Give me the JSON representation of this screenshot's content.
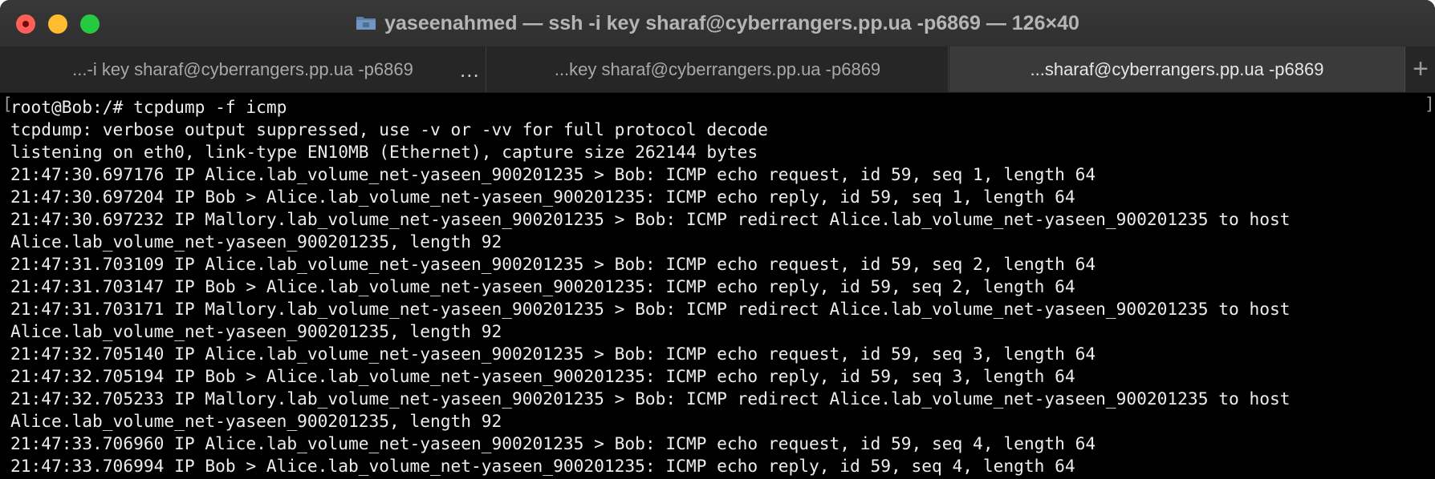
{
  "window": {
    "title": "yaseenahmed — ssh -i key sharaf@cyberrangers.pp.ua -p6869 — 126×40"
  },
  "tabs": [
    {
      "label": "...-i key sharaf@cyberrangers.pp.ua -p6869",
      "active": false
    },
    {
      "label": "...key sharaf@cyberrangers.pp.ua -p6869",
      "active": false
    },
    {
      "label": "...sharaf@cyberrangers.pp.ua -p6869",
      "active": true
    }
  ],
  "tab_overflow": "...",
  "new_tab_label": "+",
  "terminal": {
    "bracket_left": "[",
    "bracket_right": "]",
    "lines": [
      "root@Bob:/# tcpdump -f icmp",
      "tcpdump: verbose output suppressed, use -v or -vv for full protocol decode",
      "listening on eth0, link-type EN10MB (Ethernet), capture size 262144 bytes",
      "21:47:30.697176 IP Alice.lab_volume_net-yaseen_900201235 > Bob: ICMP echo request, id 59, seq 1, length 64",
      "21:47:30.697204 IP Bob > Alice.lab_volume_net-yaseen_900201235: ICMP echo reply, id 59, seq 1, length 64",
      "21:47:30.697232 IP Mallory.lab_volume_net-yaseen_900201235 > Bob: ICMP redirect Alice.lab_volume_net-yaseen_900201235 to host",
      "Alice.lab_volume_net-yaseen_900201235, length 92",
      "21:47:31.703109 IP Alice.lab_volume_net-yaseen_900201235 > Bob: ICMP echo request, id 59, seq 2, length 64",
      "21:47:31.703147 IP Bob > Alice.lab_volume_net-yaseen_900201235: ICMP echo reply, id 59, seq 2, length 64",
      "21:47:31.703171 IP Mallory.lab_volume_net-yaseen_900201235 > Bob: ICMP redirect Alice.lab_volume_net-yaseen_900201235 to host",
      "Alice.lab_volume_net-yaseen_900201235, length 92",
      "21:47:32.705140 IP Alice.lab_volume_net-yaseen_900201235 > Bob: ICMP echo request, id 59, seq 3, length 64",
      "21:47:32.705194 IP Bob > Alice.lab_volume_net-yaseen_900201235: ICMP echo reply, id 59, seq 3, length 64",
      "21:47:32.705233 IP Mallory.lab_volume_net-yaseen_900201235 > Bob: ICMP redirect Alice.lab_volume_net-yaseen_900201235 to host",
      "Alice.lab_volume_net-yaseen_900201235, length 92",
      "21:47:33.706960 IP Alice.lab_volume_net-yaseen_900201235 > Bob: ICMP echo request, id 59, seq 4, length 64",
      "21:47:33.706994 IP Bob > Alice.lab_volume_net-yaseen_900201235: ICMP echo reply, id 59, seq 4, length 64"
    ]
  },
  "colors": {
    "close": "#fe5f57",
    "minimize": "#febc2e",
    "zoom": "#28c840",
    "terminal_bg": "#000000",
    "terminal_fg": "#ededed"
  }
}
